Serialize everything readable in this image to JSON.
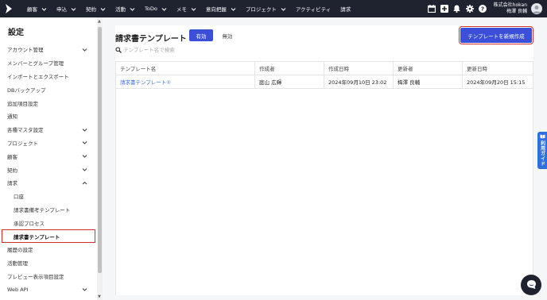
{
  "nav": {
    "items": [
      {
        "label": "顧客",
        "dropdown": true
      },
      {
        "label": "申込",
        "dropdown": true
      },
      {
        "label": "契約",
        "dropdown": true
      },
      {
        "label": "活動",
        "dropdown": true
      },
      {
        "label": "ToDo",
        "dropdown": true
      },
      {
        "label": "メモ",
        "dropdown": true
      },
      {
        "label": "意向把握",
        "dropdown": true
      },
      {
        "label": "プロジェクト",
        "dropdown": true
      },
      {
        "label": "アクティビティ",
        "dropdown": false
      },
      {
        "label": "請求",
        "dropdown": false
      }
    ],
    "icons": [
      "calendar-icon",
      "plus-square-icon",
      "bell-icon",
      "gear-icon",
      "help-icon"
    ],
    "company": "株式会社hokan",
    "user": "梅澤 良輔"
  },
  "sidebar": {
    "title": "設定",
    "items": [
      {
        "label": "アカウント管理",
        "chevron": "down",
        "sub": false
      },
      {
        "label": "メンバーとグループ管理",
        "chevron": "",
        "sub": false
      },
      {
        "label": "インポートとエクスポート",
        "chevron": "",
        "sub": false
      },
      {
        "label": "DBバックアップ",
        "chevron": "",
        "sub": false
      },
      {
        "label": "追加項目設定",
        "chevron": "",
        "sub": false
      },
      {
        "label": "通知",
        "chevron": "",
        "sub": false
      },
      {
        "label": "各種マスタ設定",
        "chevron": "down",
        "sub": false
      },
      {
        "label": "プロジェクト",
        "chevron": "down",
        "sub": false
      },
      {
        "label": "顧客",
        "chevron": "down",
        "sub": false
      },
      {
        "label": "契約",
        "chevron": "down",
        "sub": false
      },
      {
        "label": "請求",
        "chevron": "up",
        "sub": false
      },
      {
        "label": "口座",
        "chevron": "",
        "sub": true
      },
      {
        "label": "請求書備考テンプレート",
        "chevron": "",
        "sub": true
      },
      {
        "label": "承認プロセス",
        "chevron": "",
        "sub": true
      },
      {
        "label": "請求書テンプレート",
        "chevron": "",
        "sub": true,
        "active": true
      },
      {
        "label": "履歴の設定",
        "chevron": "",
        "sub": false
      },
      {
        "label": "活動管理",
        "chevron": "",
        "sub": false
      },
      {
        "label": "プレビュー表示項目設定",
        "chevron": "",
        "sub": false
      },
      {
        "label": "Web API",
        "chevron": "down",
        "sub": false
      }
    ]
  },
  "main": {
    "title": "請求書テンプレート",
    "tab_enabled": "有効",
    "tab_disabled": "無効",
    "create_button": "テンプレートを新規作成",
    "search_placeholder": "テンプレート名で検索",
    "table": {
      "headers": [
        "テンプレート名",
        "作成者",
        "作成日時",
        "更新者",
        "更新日時"
      ],
      "rows": [
        [
          "請求書テンプレート①",
          "庭山 広輝",
          "2024年09月10日 23:02",
          "梅澤 良輔",
          "2024年09月20日 15:15"
        ]
      ]
    }
  },
  "guide_tab": {
    "label": "利用ガイド"
  },
  "colors": {
    "nav_bg": "#1f2330",
    "accent": "#3b4fd8",
    "link": "#3b6fd8",
    "highlight": "#d62d2d",
    "guide": "#2f6fe0"
  }
}
